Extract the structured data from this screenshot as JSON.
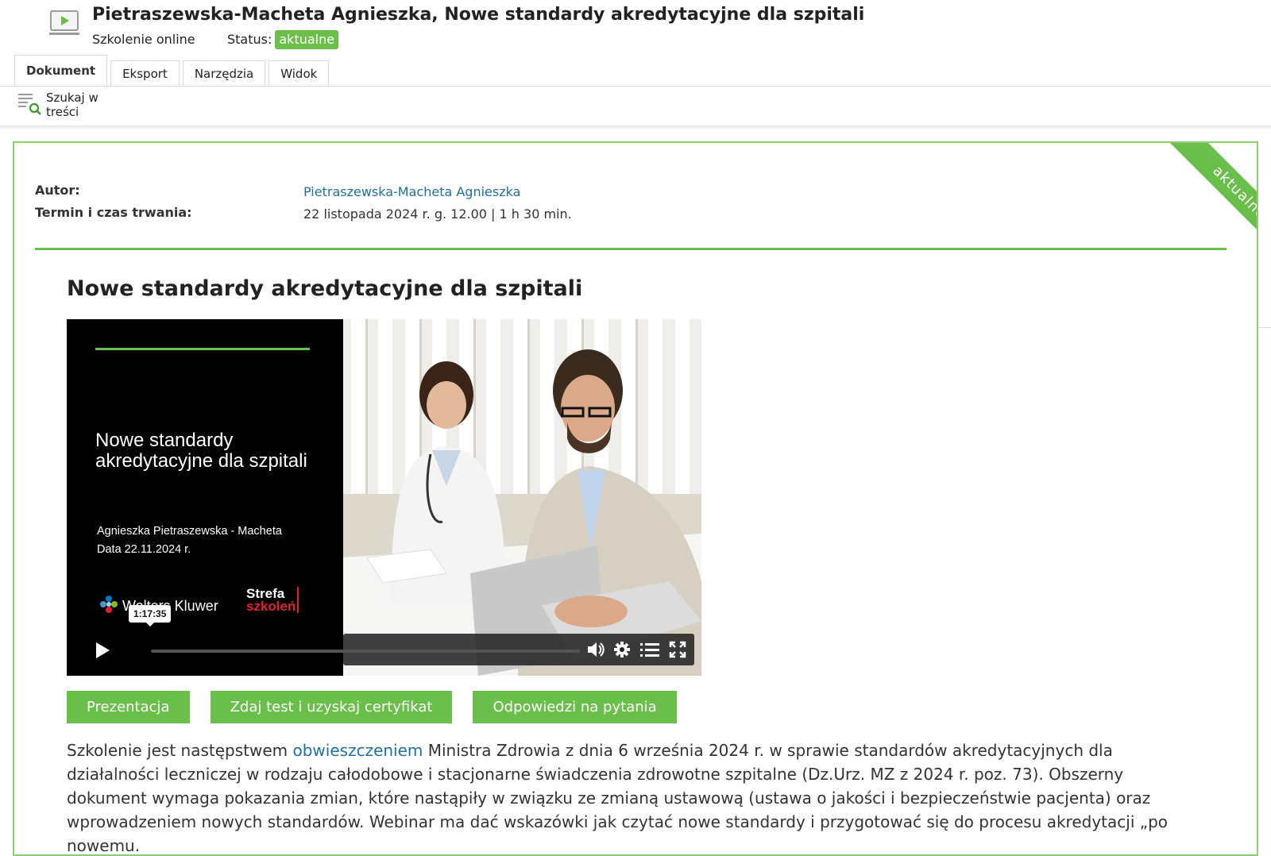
{
  "header": {
    "title": "Pietraszewska-Macheta Agnieszka, Nowe standardy akredytacyjne dla szpitali",
    "type": "Szkolenie online",
    "status_label": "Status:",
    "status_value": "aktualne"
  },
  "tabs": [
    {
      "label": "Dokument",
      "active": true
    },
    {
      "label": "Eksport",
      "active": false
    },
    {
      "label": "Narzędzia",
      "active": false
    },
    {
      "label": "Widok",
      "active": false
    }
  ],
  "toolbar": {
    "search_label": "Szukaj w treści"
  },
  "card": {
    "ribbon": "aktualne",
    "meta": [
      {
        "label": "Autor:",
        "value": "Pietraszewska-Macheta Agnieszka",
        "link": true
      },
      {
        "label": "Termin i czas trwania:",
        "value": "22 listopada 2024 r. g. 12.00 | 1 h 30 min.",
        "link": false
      }
    ],
    "section_title": "Nowe standardy akredytacyjne dla szpitali"
  },
  "video": {
    "slide_title": "Nowe standardy akredytacyjne dla szpitali",
    "slide_author": "Agnieszka Pietraszewska - Macheta",
    "slide_date": "Data 22.11.2024 r.",
    "logo_text": "Wolters Kluwer",
    "strefa_line1": "Strefa",
    "strefa_line2": "szkoleń",
    "time_tooltip": "1:17:35"
  },
  "buttons": {
    "presentation": "Prezentacja",
    "test": "Zdaj test i uzyskaj certyfikat",
    "answers": "Odpowiedzi na pytania"
  },
  "description": {
    "before_link": "Szkolenie jest następstwem ",
    "link": "obwieszczeniem",
    "after_link": " Ministra Zdrowia z dnia 6 września 2024 r. w sprawie standardów akredytacyjnych dla działalności leczniczej w rodzaju całodobowe i stacjonarne świadczenia zdrowotne szpitalne (Dz.Urz. MZ z 2024 r. poz. 73). Obszerny dokument wymaga pokazania zmian, które nastąpiły w związku ze zmianą ustawową (ustawa o jakości i bezpieczeństwie pacjenta) oraz wprowadzeniem nowych standardów. Webinar ma dać wskazówki jak czytać nowe standardy i przygotować się do procesu akredytacji „po nowemu."
  },
  "colors": {
    "accent": "#6abf4b",
    "link": "#1f6fa8",
    "brand_red": "#e5202e"
  }
}
